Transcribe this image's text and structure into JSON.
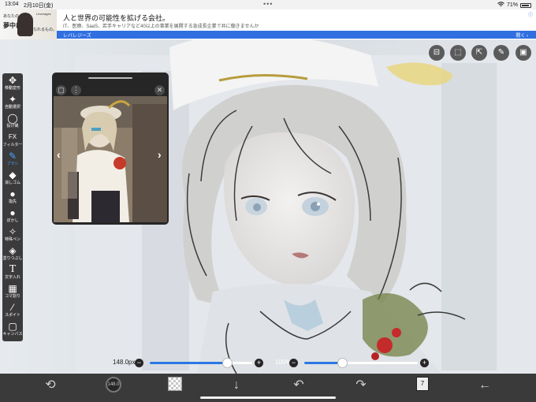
{
  "status_bar": {
    "time": "13:04",
    "date": "2月10日(金)",
    "battery": "71%"
  },
  "ad": {
    "thumb_small_text": "あなたの",
    "thumb_big_text": "夢中に",
    "thumb_tag_text": "なれるもの。",
    "thumb_brand": "Leverages",
    "title": "人と世界の可能性を拡げる会社。",
    "description": "IT、医療、SaaS、若手キャリアなど40以上の事業を展開する急成長企業で共に働きませんか",
    "sponsor": "レバレジーズ",
    "open_label": "開く",
    "info_icon": "ad-info-icon"
  },
  "toolbar": {
    "tools": [
      {
        "label": "移動変形",
        "icon": "move-icon",
        "glyph": "✥",
        "active": false
      },
      {
        "label": "自動選択",
        "icon": "magic-wand-icon",
        "glyph": "✦",
        "active": false
      },
      {
        "label": "投げ縄",
        "icon": "lasso-icon",
        "glyph": "◯",
        "active": false
      },
      {
        "label": "フィルター",
        "icon": "filter-icon",
        "glyph": "FX",
        "active": false
      },
      {
        "label": "ブラシ",
        "icon": "brush-icon",
        "glyph": "✎",
        "active": true
      },
      {
        "label": "消しゴム",
        "icon": "eraser-icon",
        "glyph": "◆",
        "active": false
      },
      {
        "label": "指先",
        "icon": "smudge-icon",
        "glyph": "●",
        "active": false
      },
      {
        "label": "ぼかし",
        "icon": "blur-icon",
        "glyph": "💧",
        "active": false
      },
      {
        "label": "特殊ペン",
        "icon": "special-pen-icon",
        "glyph": "✧",
        "active": false
      },
      {
        "label": "塗りつぶし",
        "icon": "fill-bucket-icon",
        "glyph": "◈",
        "active": false
      },
      {
        "label": "文字入れ",
        "icon": "text-icon",
        "glyph": "T",
        "active": false
      },
      {
        "label": "コマ割り",
        "icon": "frame-divider-icon",
        "glyph": "▦",
        "active": false
      },
      {
        "label": "スポイト",
        "icon": "eyedropper-icon",
        "glyph": "⁄",
        "active": false
      },
      {
        "label": "キャンバス",
        "icon": "canvas-icon",
        "glyph": "▢",
        "active": false
      }
    ]
  },
  "reference": {
    "window_icon": "window-icon",
    "more_icon": "more-icon",
    "close_icon": "close-icon",
    "prev_icon": "chevron-left-icon",
    "next_icon": "chevron-right-icon"
  },
  "top_right_tools": [
    {
      "icon": "material-icon",
      "glyph": "⊟"
    },
    {
      "icon": "selection-icon",
      "glyph": "⬚"
    },
    {
      "icon": "transform-icon",
      "glyph": "⇱"
    },
    {
      "icon": "pen-edit-icon",
      "glyph": "✎"
    },
    {
      "icon": "image-icon",
      "glyph": "▣"
    }
  ],
  "sliders": {
    "brush_size_label": "148.0px",
    "brush_size_fraction": 0.75,
    "opacity_label": "100%",
    "opacity_fraction": 0.33,
    "minus": "−",
    "plus": "+"
  },
  "bottom_bar": {
    "brush_preview_label": "148.0",
    "layer_count": "7",
    "items": [
      {
        "name": "rotate-canvas-icon",
        "glyph": "⟲"
      },
      {
        "name": "import-icon",
        "glyph": "↓"
      },
      {
        "name": "undo-icon",
        "glyph": "↶"
      },
      {
        "name": "redo-icon",
        "glyph": "↷"
      },
      {
        "name": "back-arrow-icon",
        "glyph": "←"
      }
    ]
  },
  "colors": {
    "accent": "#2a78e4",
    "toolbar_bg": "#3b3b3b",
    "bottom_bg": "#3a3a3a",
    "ad_bar": "#2f6fe0"
  }
}
